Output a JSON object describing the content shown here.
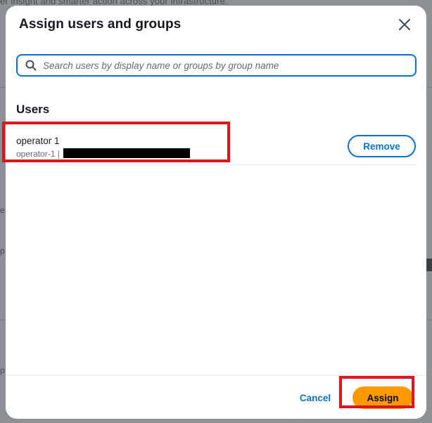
{
  "background": {
    "top_text": "er insight and smarter action across your infrastructure.",
    "fragments": [
      "e",
      "p",
      "p"
    ]
  },
  "modal": {
    "title": "Assign users and groups",
    "close_icon": "close-icon",
    "search": {
      "placeholder": "Search users by display name or groups by group name",
      "value": "",
      "icon": "search-icon"
    },
    "users_section": {
      "title": "Users",
      "items": [
        {
          "display_name": "operator 1",
          "username": "operator-1",
          "separator": "|",
          "detail_redacted": true,
          "remove_label": "Remove"
        }
      ]
    },
    "footer": {
      "cancel_label": "Cancel",
      "assign_label": "Assign"
    }
  },
  "colors": {
    "accent": "#0972d3",
    "primary_button": "#ff9900",
    "highlight": "#e0141e",
    "text": "#16191f",
    "muted_text": "#5f6b7a"
  }
}
